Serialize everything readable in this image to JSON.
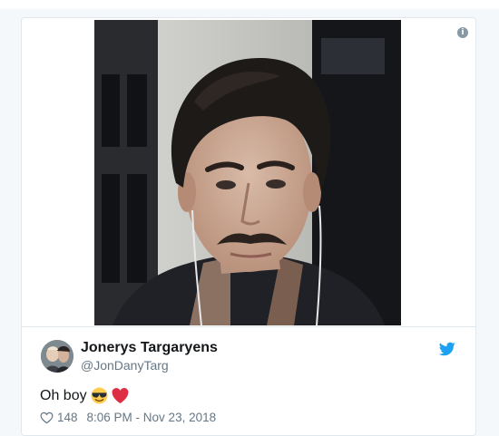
{
  "tweet": {
    "display_name": "Jonerys Targaryens",
    "handle": "@JonDanyTarg",
    "text": "Oh boy",
    "emojis": [
      "smiling-face-with-sunglasses-icon",
      "red-heart-icon"
    ],
    "like_count": "148",
    "timestamp": "8:06 PM - Nov 23, 2018"
  },
  "icons": {
    "info": "info-icon",
    "brand": "twitter-bird-icon",
    "like": "heart-outline-icon"
  },
  "colors": {
    "brand_blue": "#1da1f2",
    "name_text": "#14171a",
    "secondary_text": "#657786",
    "border": "#e1e8ed",
    "emoji_heart": "#dd2e44",
    "emoji_face": "#ffcc4d"
  }
}
